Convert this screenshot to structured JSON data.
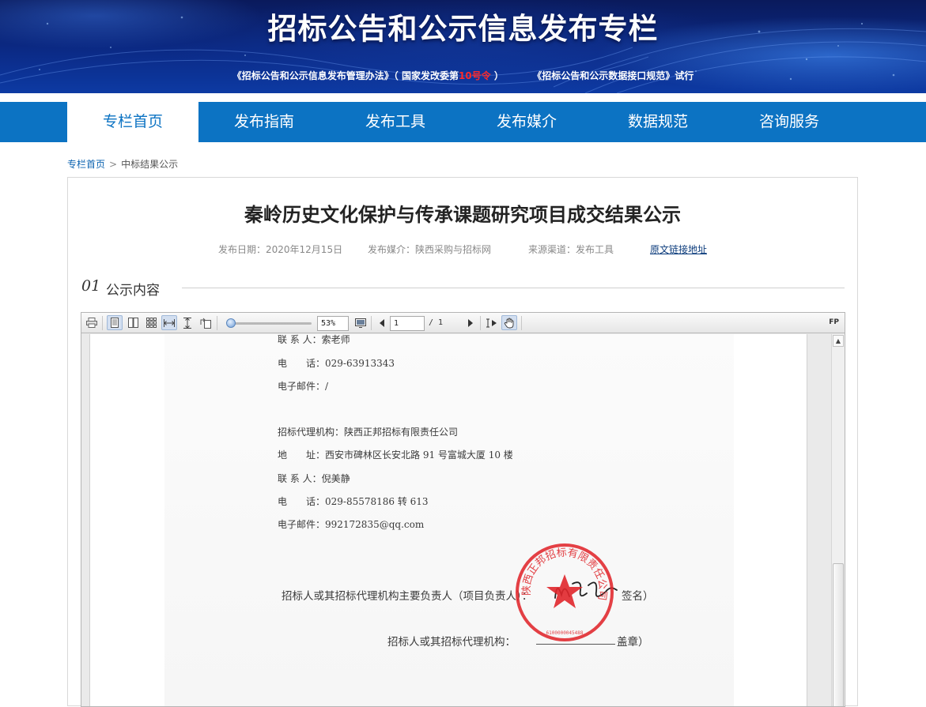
{
  "banner": {
    "title": "招标公告和公示信息发布专栏",
    "link1_prefix": "《招标公告和公示信息发布管理办法》（ 国家发改委第",
    "link1_highlight": "10号令",
    "link1_suffix": " ）",
    "link2": "《招标公告和公示数据接口规范》试行"
  },
  "nav": {
    "items": [
      {
        "label": "专栏首页"
      },
      {
        "label": "发布指南"
      },
      {
        "label": "发布工具"
      },
      {
        "label": "发布媒介"
      },
      {
        "label": "数据规范"
      },
      {
        "label": "咨询服务"
      }
    ],
    "active_index": 0
  },
  "breadcrumb": {
    "home": "专栏首页",
    "separator": ">",
    "current": "中标结果公示"
  },
  "article": {
    "title": "秦岭历史文化保护与传承课题研究项目成交结果公示",
    "publish_date": "发布日期：2020年12月15日",
    "media": "发布媒介：陕西采购与招标网",
    "source": "来源渠道：发布工具",
    "original_link": "原文链接地址"
  },
  "section": {
    "number": "01",
    "label": "公示内容"
  },
  "viewer": {
    "zoom": "53%",
    "page_current": "1",
    "page_total": "/ 1",
    "fp_label": "FP",
    "zoom_slider_fraction": 0.05
  },
  "document": {
    "lines": [
      "联 系 人：索老师",
      "电　　话：029-63913343",
      "电子邮件：/",
      "招标代理机构：陕西正邦招标有限责任公司",
      "地　　址：西安市碑林区长安北路 91 号富城大厦 10 楼",
      "联 系 人：倪美静",
      "电　　话：029-85578186 转 613",
      "电子邮件：992172835@qq.com"
    ],
    "signature_line": "招标人或其招标代理机构主要负责人（项目负责人）：",
    "signature_suffix": "签名）",
    "stamp_line": "招标人或其招标代理机构：",
    "stamp_suffix": "盖章）",
    "seal_text": "陕西正邦招标有限责任公司",
    "seal_number": "6100000045488"
  },
  "colors": {
    "nav_blue": "#0c73c3",
    "banner_dark": "#0a1a5c",
    "highlight_red": "#ff2a2a",
    "seal_red": "#e0262b"
  }
}
